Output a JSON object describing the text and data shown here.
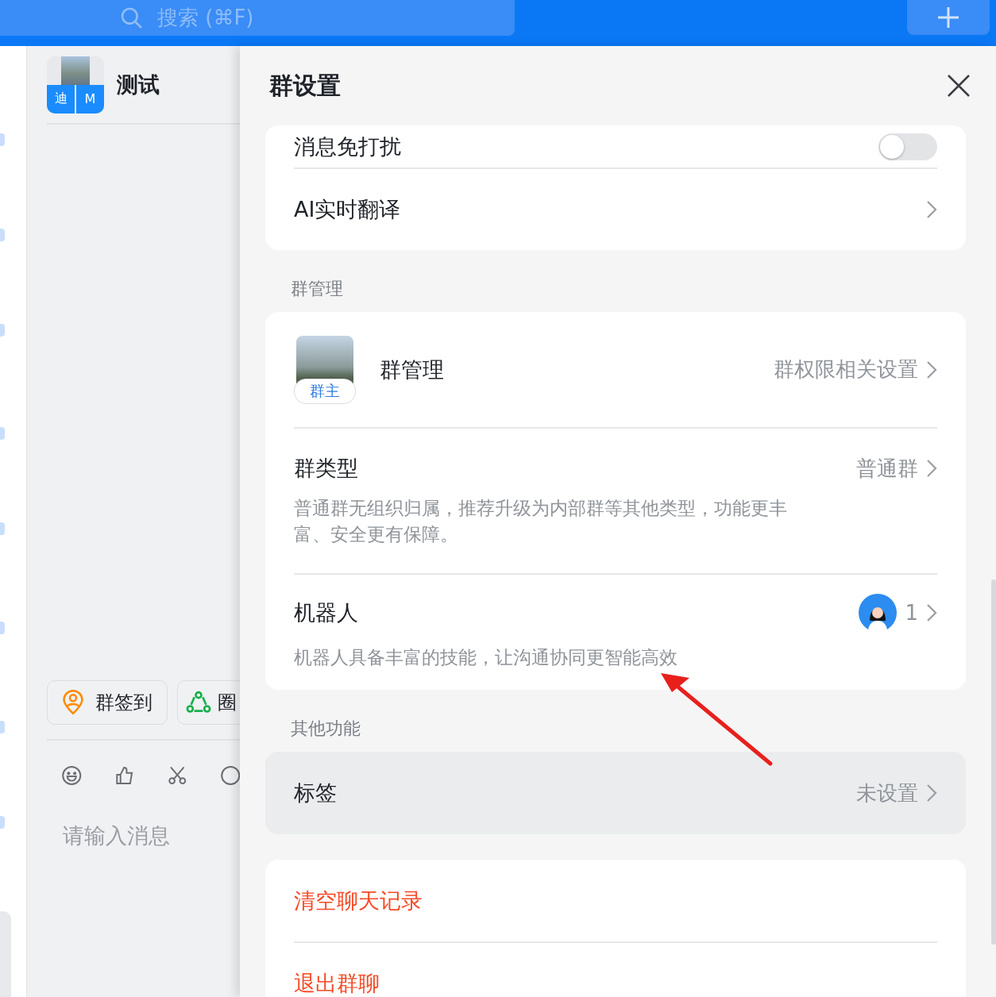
{
  "search": {
    "placeholder": "搜索 (⌘F)"
  },
  "chat": {
    "title": "测试",
    "avatar_tiles": [
      "迪",
      "M"
    ],
    "quick_actions": [
      {
        "label": "群签到",
        "kind": "checkin"
      },
      {
        "label": "圈",
        "kind": "circle"
      }
    ],
    "message_placeholder": "请输入消息"
  },
  "panel": {
    "title": "群设置",
    "groups": [
      {
        "rows": [
          {
            "kind": "toggle",
            "label": "消息免打扰",
            "on": false
          },
          {
            "kind": "link",
            "label": "AI实时翻译"
          }
        ]
      },
      {
        "heading": "群管理",
        "rows": [
          {
            "kind": "admin",
            "label": "群管理",
            "badge": "群主",
            "value": "群权限相关设置"
          },
          {
            "kind": "link",
            "label": "群类型",
            "value": "普通群",
            "description": "普通群无组织归属，推荐升级为内部群等其他类型，功能更丰富、安全更有保障。"
          },
          {
            "kind": "robot",
            "label": "机器人",
            "value": "1",
            "description": "机器人具备丰富的技能，让沟通协同更智能高效"
          }
        ]
      },
      {
        "heading": "其他功能",
        "rows": [
          {
            "kind": "link",
            "label": "标签",
            "value": "未设置",
            "hovered": true
          }
        ]
      },
      {
        "rows": [
          {
            "kind": "danger",
            "label": "清空聊天记录"
          },
          {
            "kind": "danger",
            "label": "退出群聊"
          }
        ]
      }
    ]
  }
}
